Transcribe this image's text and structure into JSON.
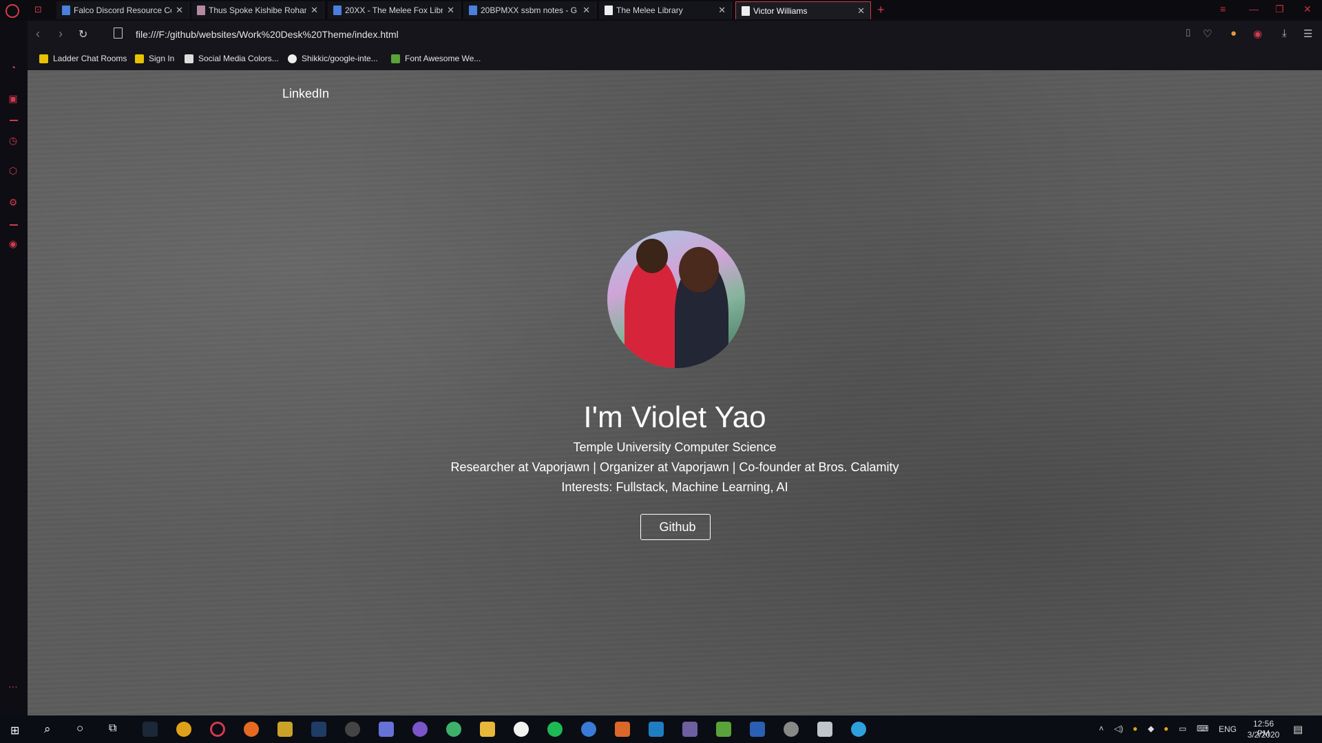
{
  "tabs": [
    {
      "title": "Falco Discord Resource Co",
      "favicon": "docs-icon"
    },
    {
      "title": "Thus Spoke Kishibe Rohan",
      "favicon": "image-icon"
    },
    {
      "title": "20XX - The Melee Fox Libra",
      "favicon": "docs-icon"
    },
    {
      "title": "20BPMXX ssbm notes - G",
      "favicon": "docs-icon"
    },
    {
      "title": "The Melee Library",
      "favicon": "page-icon"
    },
    {
      "title": "Victor Williams",
      "favicon": "page-icon",
      "active": true
    }
  ],
  "address": {
    "url": "file:///F:/github/websites/Work%20Desk%20Theme/index.html"
  },
  "bookmarks": [
    {
      "label": "Ladder Chat Rooms"
    },
    {
      "label": "Sign In"
    },
    {
      "label": "Social Media Colors..."
    },
    {
      "label": "Shikkic/google-inte..."
    },
    {
      "label": "Font Awesome We..."
    }
  ],
  "page": {
    "nav_link": "LinkedIn",
    "name": "I'm Violet Yao",
    "school": "Temple University Computer Science",
    "roles": "Researcher at Vaporjawn | Organizer at Vaporjawn | Co-founder at Bros. Calamity",
    "interests": "Interests: Fullstack, Machine Learning, AI",
    "github_button": "Github",
    "github_glyph": ""
  },
  "taskbar": {
    "language": "ENG",
    "time": "12:56 PM",
    "date": "3/2/2020"
  },
  "colors": {
    "accent": "#d23a4e",
    "bg_texture": "#5c5c5c"
  }
}
